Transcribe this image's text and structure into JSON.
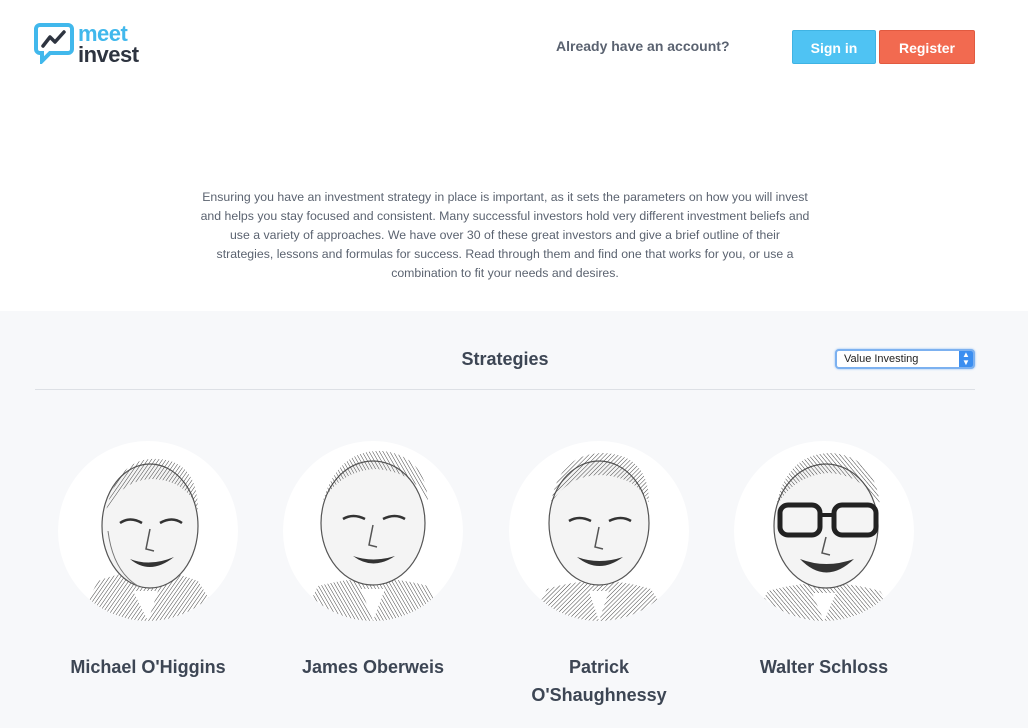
{
  "header": {
    "logo_meet": "meet",
    "logo_invest": "invest",
    "account_prompt": "Already have an account?",
    "signin_label": "Sign in",
    "register_label": "Register",
    "colors": {
      "signin": "#4fc3f3",
      "register": "#f26a50",
      "logo_accent": "#41b8ec"
    }
  },
  "intro": {
    "text": "Ensuring you have an investment strategy in place is important, as it sets the parameters on how you will invest and helps you stay focused and consistent. Many successful investors hold very different investment beliefs and use a variety of approaches. We have over 30 of these great investors and give a brief outline of their strategies, lessons and formulas for success. Read through them and find one that works for you, or use a combination to fit your needs and desires."
  },
  "strategies": {
    "title": "Strategies",
    "select_value": "Value Investing",
    "investors": [
      {
        "name": "Michael O'Higgins"
      },
      {
        "name": "James Oberweis"
      },
      {
        "name": "Patrick O'Shaughnessy"
      },
      {
        "name": "Walter Schloss"
      }
    ]
  }
}
